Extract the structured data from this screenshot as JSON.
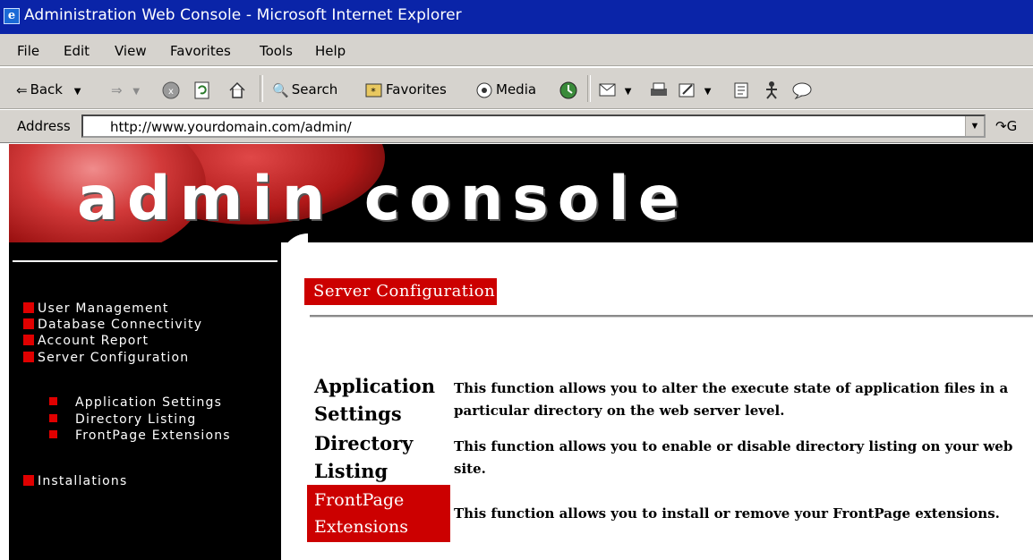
{
  "window": {
    "title": "Administration Web Console - Microsoft Internet Explorer"
  },
  "menubar": {
    "items": [
      "File",
      "Edit",
      "View",
      "Favorites",
      "Tools",
      "Help"
    ]
  },
  "toolbar": {
    "back": "Back",
    "search": "Search",
    "favorites": "Favorites",
    "media": "Media"
  },
  "address": {
    "label": "Address",
    "url": "http://www.yourdomain.com/admin/",
    "go": "G"
  },
  "banner": {
    "logo_text": "admin console"
  },
  "sidebar": {
    "items": [
      "User Management",
      "Database Connectivity",
      "Account Report",
      "Server Configuration"
    ],
    "subitems": [
      "Application Settings",
      "Directory Listing",
      "FrontPage Extensions"
    ],
    "installations": "Installations"
  },
  "main": {
    "section_title": "Server Configuration",
    "functions": [
      {
        "name_line1": "Application",
        "name_line2": "Settings",
        "description": "This function allows you to alter the execute state of application files in a particular directory on the web server level."
      },
      {
        "name_line1": "Directory",
        "name_line2": "Listing",
        "description": "This function allows you to enable or disable directory listing on your web site."
      },
      {
        "name_line1": "FrontPage",
        "name_line2": "Extensions",
        "description": "This function allows you to install or remove your FrontPage extensions."
      }
    ]
  },
  "colors": {
    "titlebar": "#0a24a8",
    "accent_red": "#cc0000",
    "chrome": "#d6d3ce"
  }
}
